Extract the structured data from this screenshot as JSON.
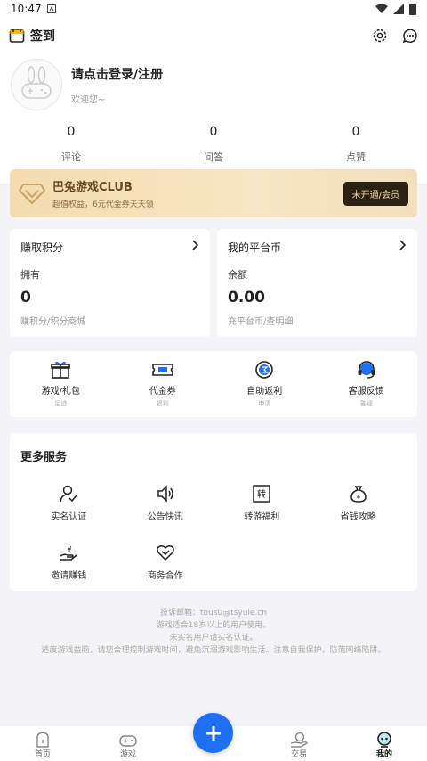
{
  "status": {
    "time": "10:47"
  },
  "topbar": {
    "checkin_label": "签到"
  },
  "profile": {
    "login": "请点击登录/注册",
    "welcome": "欢迎您~"
  },
  "stats": [
    {
      "value": "0",
      "label": "评论"
    },
    {
      "value": "0",
      "label": "问答"
    },
    {
      "value": "0",
      "label": "点赞"
    }
  ],
  "vip": {
    "title": "巴兔游戏CLUB",
    "subtitle": "超值权益，6元代金券天天领",
    "button": "未开通/会员"
  },
  "points": {
    "title": "赚取积分",
    "own_label": "拥有",
    "value": "0",
    "link": "赚积分/积分商城"
  },
  "coins": {
    "title": "我的平台币",
    "own_label": "余额",
    "value": "0.00",
    "link": "充平台币/查明细"
  },
  "quick": [
    {
      "label": "游戏/礼包",
      "sub": "足迹"
    },
    {
      "label": "代金券",
      "sub": "福利"
    },
    {
      "label": "自助返利",
      "sub": "申请"
    },
    {
      "label": "客服反馈",
      "sub": "答疑"
    }
  ],
  "more": {
    "title": "更多服务",
    "items": [
      {
        "label": "实名认证"
      },
      {
        "label": "公告快讯"
      },
      {
        "label": "转游福利"
      },
      {
        "label": "省钱攻略"
      },
      {
        "label": "邀请赚钱"
      },
      {
        "label": "商务合作"
      }
    ]
  },
  "footer": {
    "line1": "投诉邮箱：tousu@tsyule.cn",
    "line2": "游戏适合18岁以上的用户使用。",
    "line3": "未实名用户请实名认证。",
    "line4": "适度游戏益脑，请您合理控制游戏时间，避免沉溺游戏影响生活。注意自我保护，防范网络陷阱。"
  },
  "tabs": [
    {
      "label": "首页"
    },
    {
      "label": "游戏"
    },
    {
      "label": "交易"
    },
    {
      "label": "我的"
    }
  ],
  "colors": {
    "accent": "#1f6ff3",
    "vip_gold": "#f4dcae"
  }
}
